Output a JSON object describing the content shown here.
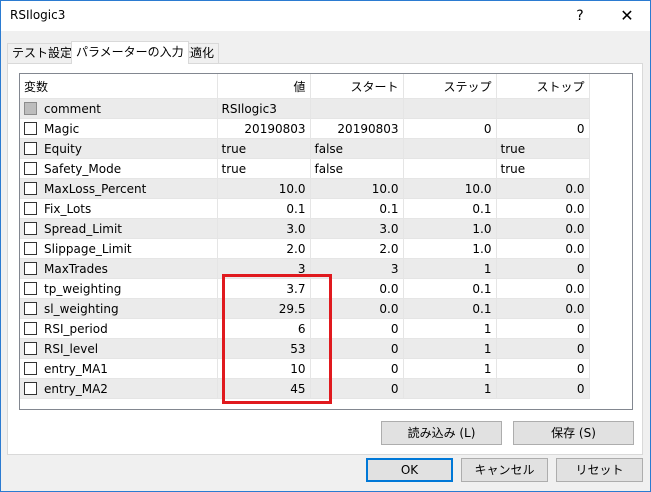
{
  "window": {
    "title": "RSIlogic3",
    "help_label": "?",
    "close_label": "✕"
  },
  "tabs": [
    {
      "label": "テスト設定"
    },
    {
      "label": "パラメーターの入力"
    },
    {
      "label": "最適化"
    }
  ],
  "table": {
    "headers": [
      "変数",
      "値",
      "スタート",
      "ステップ",
      "ストップ"
    ],
    "rows": [
      {
        "name": "comment",
        "value": "RSIlogic3",
        "start": "",
        "step": "",
        "stop": "",
        "checkbox_enabled": false
      },
      {
        "name": "Magic",
        "value": "20190803",
        "start": "20190803",
        "step": "0",
        "stop": "0",
        "checkbox_enabled": true
      },
      {
        "name": "Equity",
        "value": "true",
        "start": "false",
        "step": "",
        "stop": "true",
        "checkbox_enabled": true
      },
      {
        "name": "Safety_Mode",
        "value": "true",
        "start": "false",
        "step": "",
        "stop": "true",
        "checkbox_enabled": true
      },
      {
        "name": "MaxLoss_Percent",
        "value": "10.0",
        "start": "10.0",
        "step": "10.0",
        "stop": "0.0",
        "checkbox_enabled": true
      },
      {
        "name": "Fix_Lots",
        "value": "0.1",
        "start": "0.1",
        "step": "0.1",
        "stop": "0.0",
        "checkbox_enabled": true
      },
      {
        "name": "Spread_Limit",
        "value": "3.0",
        "start": "3.0",
        "step": "1.0",
        "stop": "0.0",
        "checkbox_enabled": true
      },
      {
        "name": "Slippage_Limit",
        "value": "2.0",
        "start": "2.0",
        "step": "1.0",
        "stop": "0.0",
        "checkbox_enabled": true
      },
      {
        "name": "MaxTrades",
        "value": "3",
        "start": "3",
        "step": "1",
        "stop": "0",
        "checkbox_enabled": true
      },
      {
        "name": "tp_weighting",
        "value": "3.7",
        "start": "0.0",
        "step": "0.1",
        "stop": "0.0",
        "checkbox_enabled": true
      },
      {
        "name": "sl_weighting",
        "value": "29.5",
        "start": "0.0",
        "step": "0.1",
        "stop": "0.0",
        "checkbox_enabled": true
      },
      {
        "name": "RSI_period",
        "value": "6",
        "start": "0",
        "step": "1",
        "stop": "0",
        "checkbox_enabled": true
      },
      {
        "name": "RSI_level",
        "value": "53",
        "start": "0",
        "step": "1",
        "stop": "0",
        "checkbox_enabled": true
      },
      {
        "name": "entry_MA1",
        "value": "10",
        "start": "0",
        "step": "1",
        "stop": "0",
        "checkbox_enabled": true
      },
      {
        "name": "entry_MA2",
        "value": "45",
        "start": "0",
        "step": "1",
        "stop": "0",
        "checkbox_enabled": true
      }
    ]
  },
  "buttons": {
    "load": "読み込み (L)",
    "save": "保存 (S)",
    "ok": "OK",
    "cancel": "キャンセル",
    "reset": "リセット"
  },
  "colors": {
    "highlight_box": "#e0191e",
    "alt_row": "#ebebeb",
    "default_button_border": "#0078d7"
  }
}
